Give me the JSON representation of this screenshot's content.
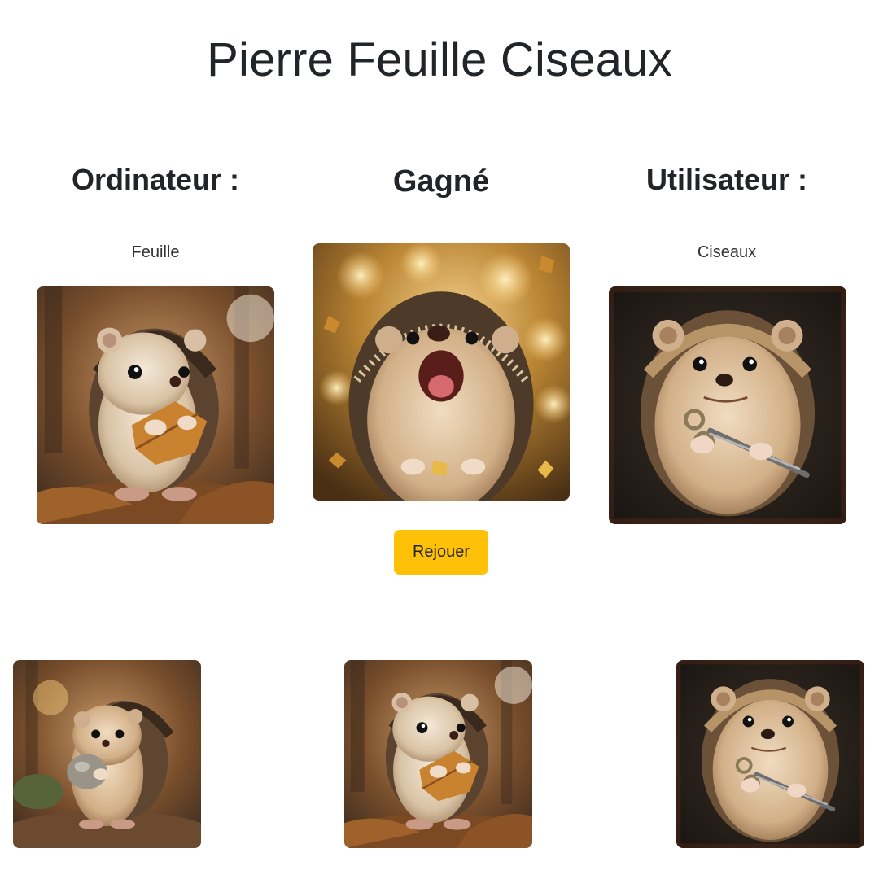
{
  "page": {
    "title": "Pierre Feuille Ciseaux"
  },
  "computer": {
    "heading": "Ordinateur :",
    "choice": "Feuille"
  },
  "result": {
    "heading": "Gagné"
  },
  "user": {
    "heading": "Utilisateur :",
    "choice": "Ciseaux"
  },
  "actions": {
    "replay_label": "Rejouer"
  },
  "choices": [
    {
      "name": "Pierre",
      "icon": "hedgehog-with-stone-image"
    },
    {
      "name": "Feuille",
      "icon": "hedgehog-with-leaf-image"
    },
    {
      "name": "Ciseaux",
      "icon": "hedgehog-with-scissors-image"
    }
  ],
  "colors": {
    "replay_button": "#ffc107",
    "text": "#212529"
  }
}
